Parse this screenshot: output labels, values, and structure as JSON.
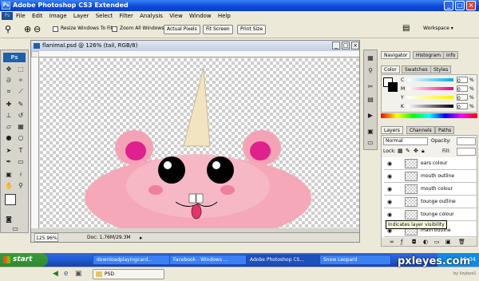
{
  "window": {
    "title": "Adobe Photoshop CS3 Extended",
    "app_icon": "Ps",
    "minimize": "_",
    "maximize": "□",
    "close": "×"
  },
  "menu": {
    "logo": "Ps",
    "items": [
      "File",
      "Edit",
      "Image",
      "Layer",
      "Select",
      "Filter",
      "Analysis",
      "View",
      "Window",
      "Help"
    ]
  },
  "options": {
    "tool_icon": "zoom-icon",
    "resize_windows": "Resize Windows To Fit",
    "zoom_all": "Zoom All Windows",
    "actual_pixels": "Actual Pixels",
    "fit_screen": "Fit Screen",
    "print_size": "Print Size",
    "workspace": "Workspace ▾"
  },
  "toolbox": {
    "logo": "Ps"
  },
  "document": {
    "title": "flanimal.psd @ 126% (tail, RGB/8)",
    "zoom": "125.96%",
    "doc_size": "Doc: 1.76M/29.3M"
  },
  "navigator": {
    "tabs": [
      "Navigator",
      "Histogram",
      "Info"
    ]
  },
  "color_panel": {
    "tabs": [
      "Color",
      "Swatches",
      "Styles"
    ],
    "channels": [
      {
        "label": "C",
        "value": "0",
        "unit": "%",
        "gradient": [
          "#ffffff",
          "#00aeef"
        ]
      },
      {
        "label": "M",
        "value": "0",
        "unit": "%",
        "gradient": [
          "#ffffff",
          "#ec008c"
        ]
      },
      {
        "label": "Y",
        "value": "0",
        "unit": "%",
        "gradient": [
          "#ffffff",
          "#fff200"
        ]
      },
      {
        "label": "K",
        "value": "0",
        "unit": "%",
        "gradient": [
          "#ffffff",
          "#000000"
        ]
      }
    ]
  },
  "layers_panel": {
    "tabs": [
      "Layers",
      "Channels",
      "Paths"
    ],
    "blend_mode": "Normal",
    "opacity_label": "Opacity:",
    "lock_label": "Lock:",
    "fill_label": "Fill:",
    "layers": [
      "ears colour",
      "mouth outline",
      "mouth colour",
      "tounge outline",
      "tounge colour",
      "main outline"
    ],
    "tooltip": "Indicates layer visibility"
  },
  "taskbar": {
    "start": "start",
    "tasks": [
      "downloadplayingcard...",
      "Facebook - Windows ...",
      "Adobe Photoshop CS...",
      "Snow Leopard"
    ],
    "time": "16:04",
    "quick_item": "PSD"
  },
  "watermark": {
    "site": "pxleyes.com",
    "author": "by lizyboo1"
  },
  "colors": {
    "accent": "#0a46d8",
    "body_pink": "#f3a3b5",
    "ear_inner": "#e0208c",
    "cone": "#f2e4c0"
  }
}
